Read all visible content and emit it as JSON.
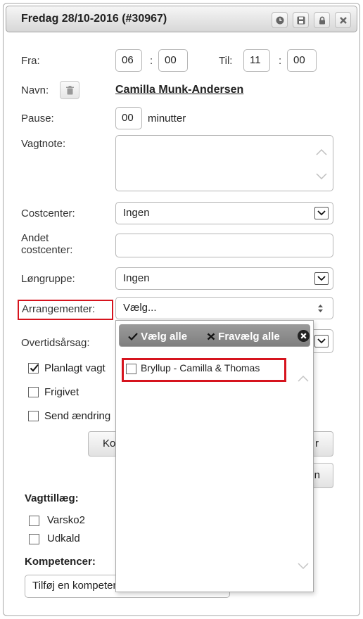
{
  "dialog": {
    "title": "Fredag 28/10-2016  (#30967)",
    "buttons": [
      "clock-icon",
      "save-icon",
      "lock-icon",
      "close-icon"
    ]
  },
  "form": {
    "fra_label": "Fra:",
    "fra_hour": "06",
    "fra_min": "00",
    "til_label": "Til:",
    "til_hour": "11",
    "til_min": "00",
    "time_sep": ":",
    "navn_label": "Navn:",
    "navn_value": "Camilla Munk-Andersen",
    "pause_label": "Pause:",
    "pause_value": "00",
    "pause_unit": "minutter",
    "vagtnote_label": "Vagtnote:",
    "costcenter_label": "Costcenter:",
    "costcenter_value": "Ingen",
    "andet_label_1": "Andet",
    "andet_label_2": "costcenter:",
    "lonnegruppe_label": "Løngruppe:",
    "lonnegruppe_value": "Ingen",
    "arrangementer_label": "Arrangementer:",
    "arrangementer_value": "Vælg...",
    "overtid_label": "Overtidsårsag:",
    "planlagt_label": "Planlagt vagt",
    "frigivet_label": "Frigivet",
    "send_label": "Send ændring",
    "btn_left_label": "Ko",
    "btn_right_label": "r",
    "btn_right2_label": "n",
    "vagttillaeg_heading": "Vagttillæg:",
    "varsko_label": "Varsko2",
    "udkald_label": "Udkald",
    "kompetencer_heading": "Kompetencer:",
    "kompetence_placeholder": "Tilføj en kompetence"
  },
  "dropdown": {
    "select_all": "Vælg alle",
    "deselect_all": "Fravælg alle",
    "options": [
      "Bryllup - Camilla & Thomas"
    ]
  },
  "colors": {
    "highlight": "#d6141e",
    "dropdown_header": "#8c8c8c"
  }
}
